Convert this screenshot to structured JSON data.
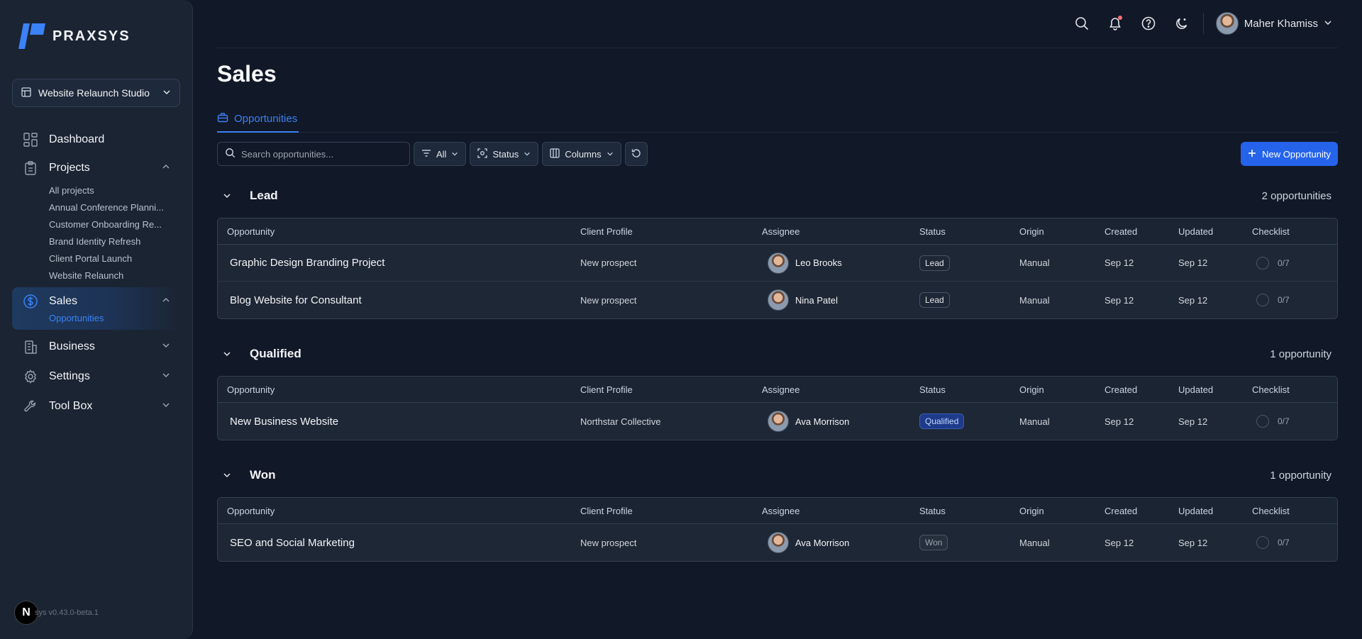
{
  "brand": {
    "name": "PRAXSYS",
    "accent": "#3b82f6"
  },
  "workspace": {
    "name": "Website Relaunch Studio"
  },
  "nav": {
    "dashboard": "Dashboard",
    "projects": "Projects",
    "project_items": [
      "All projects",
      "Annual Conference Planni...",
      "Customer Onboarding Re...",
      "Brand Identity Refresh",
      "Client Portal Launch",
      "Website Relaunch"
    ],
    "sales": "Sales",
    "sales_items": [
      "Opportunities"
    ],
    "business": "Business",
    "settings": "Settings",
    "toolbox": "Tool Box"
  },
  "version": {
    "badge": "N",
    "text": "sys v0.43.0-beta.1"
  },
  "user": {
    "name": "Maher Khamiss"
  },
  "page": {
    "title": "Sales",
    "tab": "Opportunities"
  },
  "toolbar": {
    "search_placeholder": "Search opportunities...",
    "filter_all": "All",
    "status": "Status",
    "columns": "Columns",
    "new_label": "New Opportunity"
  },
  "columns": [
    "Opportunity",
    "Client Profile",
    "Assignee",
    "Status",
    "Origin",
    "Created",
    "Updated",
    "Checklist"
  ],
  "groups": [
    {
      "title": "Lead",
      "count": "2 opportunities",
      "rows": [
        {
          "opportunity": "Graphic Design Branding Project",
          "client": "New prospect",
          "assignee": "Leo Brooks",
          "status": "Lead",
          "origin": "Manual",
          "created": "Sep 12",
          "updated": "Sep 12",
          "checklist": "0/7"
        },
        {
          "opportunity": "Blog Website for Consultant",
          "client": "New prospect",
          "assignee": "Nina Patel",
          "status": "Lead",
          "origin": "Manual",
          "created": "Sep 12",
          "updated": "Sep 12",
          "checklist": "0/7"
        }
      ]
    },
    {
      "title": "Qualified",
      "count": "1 opportunity",
      "rows": [
        {
          "opportunity": "New Business Website",
          "client": "Northstar Collective",
          "assignee": "Ava Morrison",
          "status": "Qualified",
          "origin": "Manual",
          "created": "Sep 12",
          "updated": "Sep 12",
          "checklist": "0/7"
        }
      ]
    },
    {
      "title": "Won",
      "count": "1 opportunity",
      "rows": [
        {
          "opportunity": "SEO and Social Marketing",
          "client": "New prospect",
          "assignee": "Ava Morrison",
          "status": "Won",
          "origin": "Manual",
          "created": "Sep 12",
          "updated": "Sep 12",
          "checklist": "0/7"
        }
      ]
    }
  ]
}
